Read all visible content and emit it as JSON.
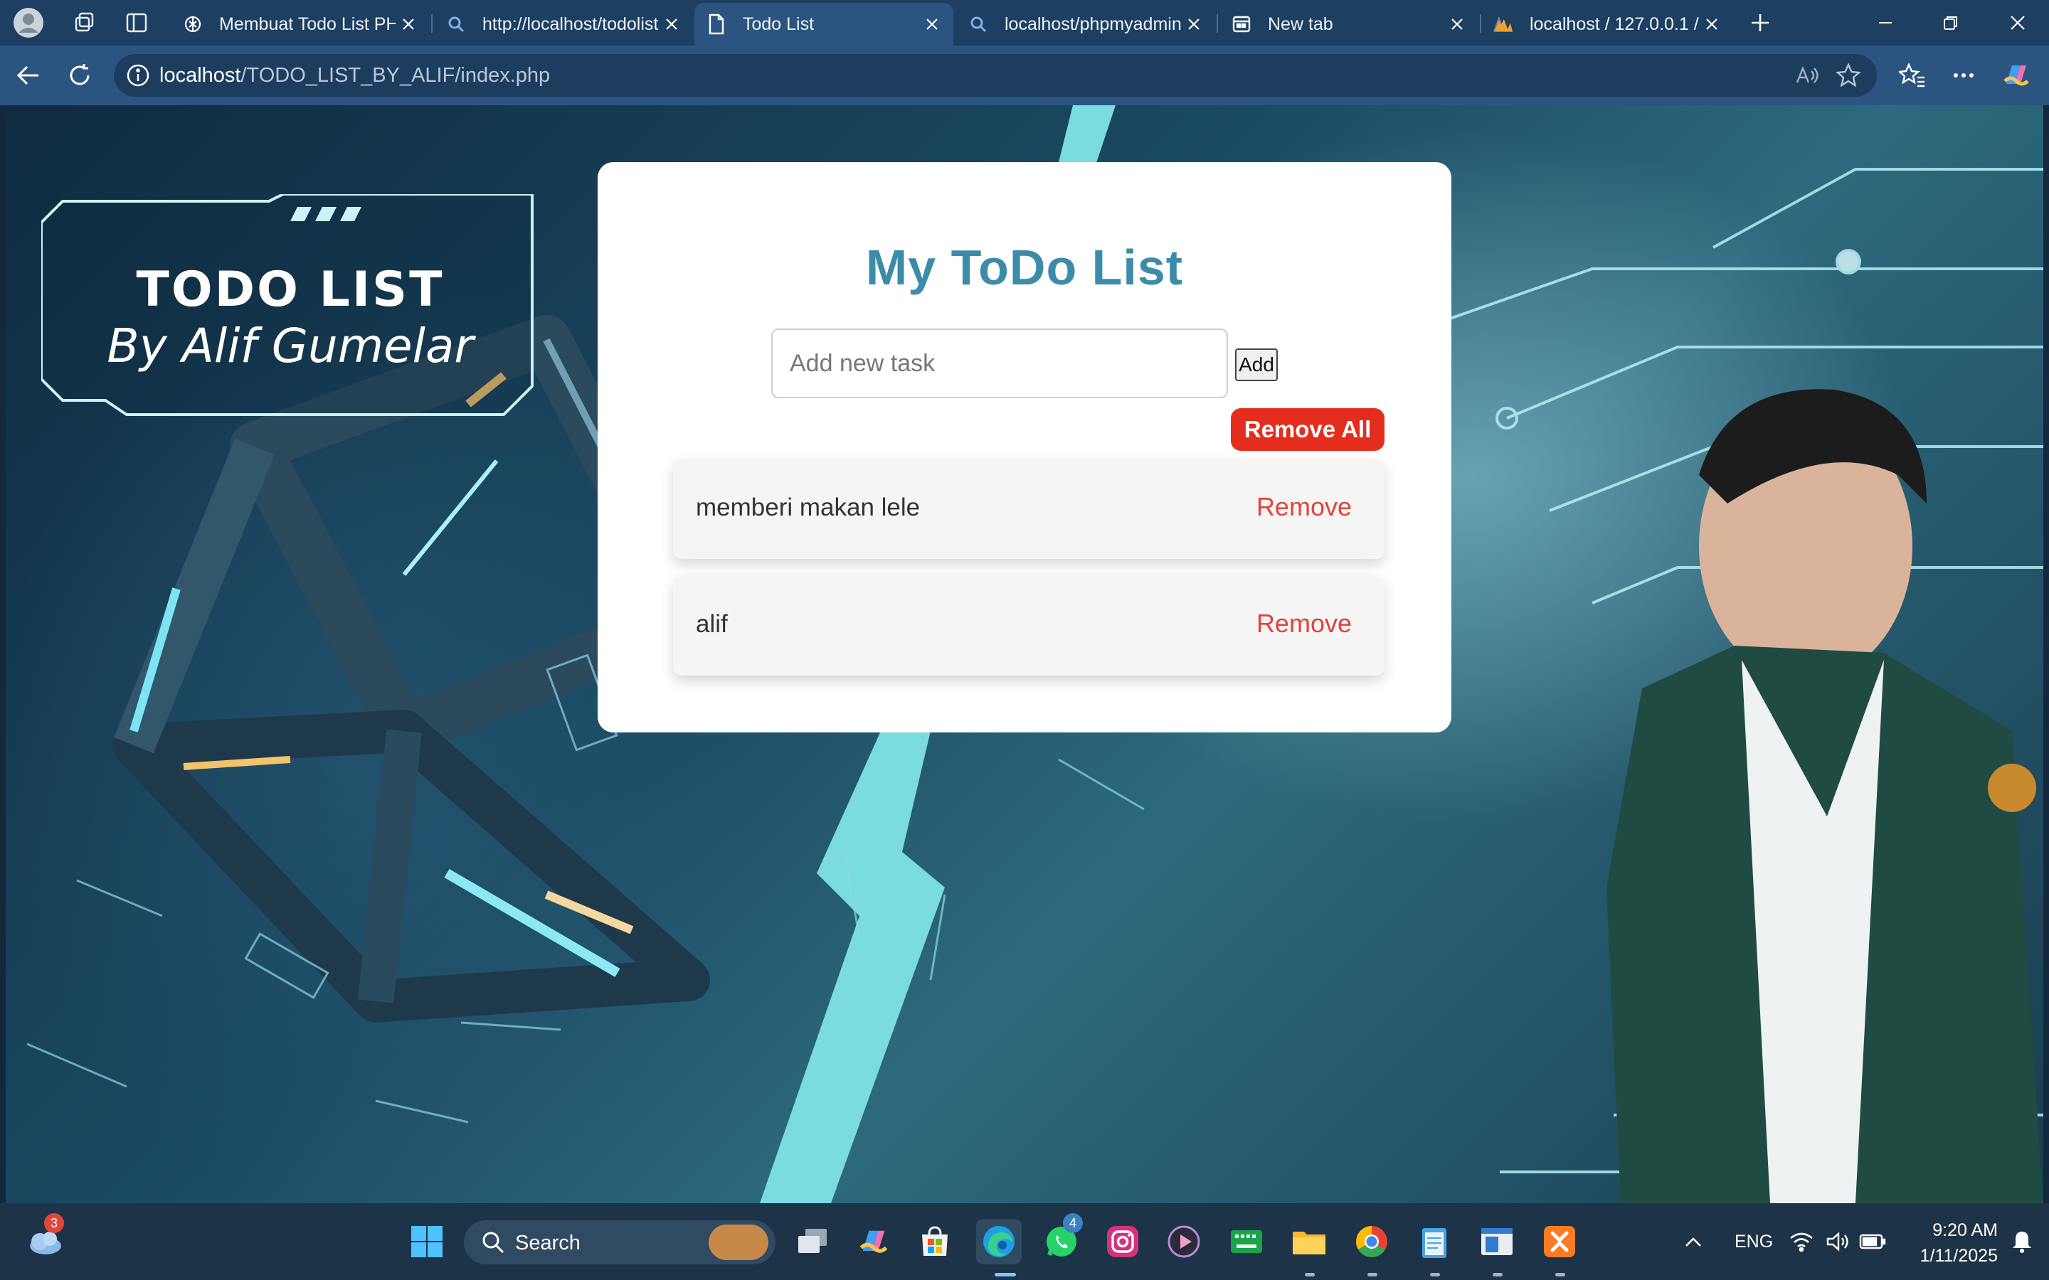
{
  "tabs": [
    {
      "title": "Membuat Todo List PHP",
      "icon": "chatgpt-icon"
    },
    {
      "title": "http://localhost/todolist",
      "icon": "search-icon"
    },
    {
      "title": "Todo List",
      "icon": "page-icon",
      "active": true
    },
    {
      "title": "localhost/phpmyadmin",
      "icon": "search-icon"
    },
    {
      "title": "New tab",
      "icon": "newtab-icon"
    },
    {
      "title": "localhost / 127.0.0.1 / t",
      "icon": "phpmyadmin-icon"
    }
  ],
  "address_bar": {
    "url_host": "localhost",
    "url_path": "/TODO_LIST_BY_ALIF/index.php"
  },
  "background_banner": {
    "line1": "TODO LIST",
    "line2": "By Alif Gumelar"
  },
  "todo": {
    "title": "My ToDo List",
    "input_placeholder": "Add new task",
    "add_label": "Add",
    "remove_all_label": "Remove All",
    "items": [
      {
        "text": "memberi makan lele",
        "remove_label": "Remove"
      },
      {
        "text": "alif",
        "remove_label": "Remove"
      }
    ]
  },
  "taskbar": {
    "search_label": "Search",
    "weather_badge": "3",
    "whatsapp_badge": "4",
    "language": "ENG",
    "time": "9:20 AM",
    "date": "1/11/2025"
  },
  "colors": {
    "title": "#3c8ca9",
    "remove_all_bg": "#e52d1e",
    "remove_link": "#e0453a",
    "tabstrip_bg": "#1c3f62",
    "toolbar_bg": "#2b5480"
  }
}
